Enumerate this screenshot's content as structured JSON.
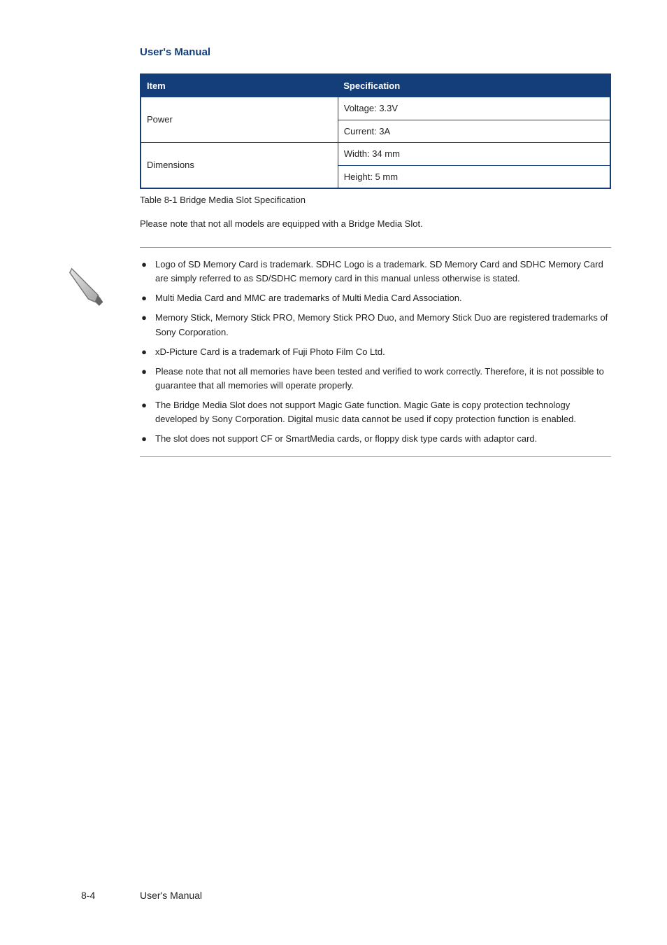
{
  "header": {
    "running": "User's Manual"
  },
  "table": {
    "head_item": "Item",
    "head_spec": "Specification",
    "rows": [
      {
        "label": "Power",
        "specs": [
          "Voltage: 3.3V",
          "Current: 3A"
        ]
      },
      {
        "label": "Dimensions",
        "specs": [
          "Width: 34 mm",
          "Height: 5 mm"
        ]
      }
    ],
    "caption": "Table 8-1 Bridge Media Slot Specification"
  },
  "inline_note": "Please note that not all models are equipped with a Bridge Media Slot.",
  "notes": [
    "Logo of SD Memory Card is trademark. SDHC Logo is a trademark. SD Memory Card and SDHC Memory Card are simply referred to as SD/SDHC memory card in this manual unless otherwise is stated.",
    "Multi Media Card and MMC are trademarks of Multi Media Card Association.",
    "Memory Stick, Memory Stick PRO, Memory Stick PRO Duo, and Memory Stick Duo are registered trademarks of Sony Corporation.",
    "xD-Picture Card is a trademark of Fuji Photo Film Co Ltd.",
    "Please note that not all memories have been tested and verified to work correctly. Therefore, it is not possible to guarantee that all memories will operate properly.",
    "The Bridge Media Slot does not support Magic Gate function. Magic Gate is copy protection technology developed by Sony Corporation. Digital music data cannot be used if copy protection function is enabled.",
    "The slot does not support CF or SmartMedia cards, or floppy disk type cards with adaptor card."
  ],
  "footer": {
    "manual": "User's Manual",
    "page": "8-4"
  }
}
